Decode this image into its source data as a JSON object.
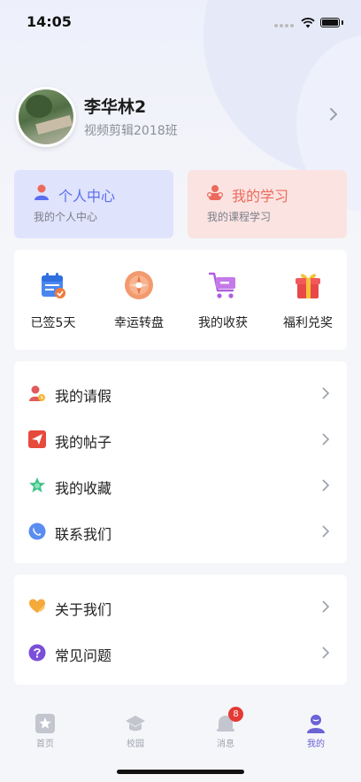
{
  "status_bar": {
    "time": "14:05"
  },
  "profile": {
    "name": "李华林2",
    "class_name": "视频剪辑2018班"
  },
  "cards": [
    {
      "title": "个人中心",
      "subtitle": "我的个人中心",
      "color": "#5b6ef0"
    },
    {
      "title": "我的学习",
      "subtitle": "我的课程学习",
      "color": "#ec6a5c"
    }
  ],
  "quick_actions": [
    {
      "label": "已签5天",
      "icon": "calendar-check-icon"
    },
    {
      "label": "幸运转盘",
      "icon": "lucky-wheel-icon"
    },
    {
      "label": "我的收获",
      "icon": "shopping-cart-icon"
    },
    {
      "label": "福利兑奖",
      "icon": "gift-icon"
    }
  ],
  "menu_group_1": [
    {
      "label": "我的请假",
      "icon": "leave-request-icon"
    },
    {
      "label": "我的帖子",
      "icon": "paper-plane-icon"
    },
    {
      "label": "我的收藏",
      "icon": "star-icon"
    },
    {
      "label": "联系我们",
      "icon": "phone-icon"
    }
  ],
  "menu_group_2": [
    {
      "label": "关于我们",
      "icon": "heart-icon"
    },
    {
      "label": "常见问题",
      "icon": "question-icon"
    }
  ],
  "tabbar": {
    "items": [
      {
        "label": "首页",
        "icon": "home-star-icon"
      },
      {
        "label": "校园",
        "icon": "graduation-cap-icon"
      },
      {
        "label": "消息",
        "icon": "message-bell-icon",
        "badge": "8"
      },
      {
        "label": "我的",
        "icon": "user-icon",
        "active": true
      }
    ],
    "active_color": "#6b63d6",
    "inactive_color": "#a0a4ae"
  }
}
